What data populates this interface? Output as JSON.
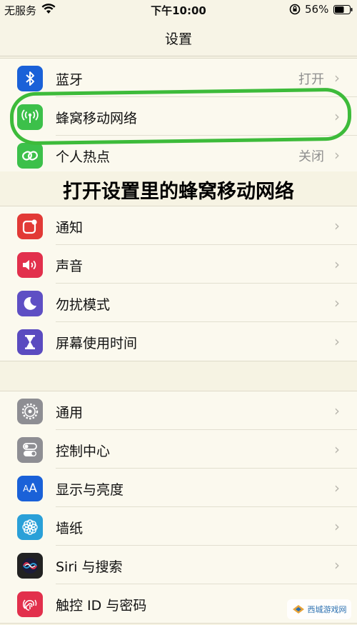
{
  "status_bar": {
    "carrier": "无服务",
    "time": "下午10:00",
    "battery": "56%"
  },
  "nav": {
    "title": "设置"
  },
  "group1": [
    {
      "label": "蓝牙",
      "value": "打开",
      "icon": "bluetooth-icon",
      "color": "#1a61d8"
    },
    {
      "label": "蜂窝移动网络",
      "value": "",
      "icon": "antenna-icon",
      "color": "#3cc04a"
    },
    {
      "label": "个人热点",
      "value": "关闭",
      "icon": "hotspot-icon",
      "color": "#3cc04a"
    }
  ],
  "caption": "打开设置里的蜂窝移动网络",
  "group2": [
    {
      "label": "通知",
      "icon": "notification-icon",
      "color": "#e23a36"
    },
    {
      "label": "声音",
      "icon": "speaker-icon",
      "color": "#e2304c"
    },
    {
      "label": "勿扰模式",
      "icon": "moon-icon",
      "color": "#5e4fc4"
    },
    {
      "label": "屏幕使用时间",
      "icon": "hourglass-icon",
      "color": "#5a4bc0"
    }
  ],
  "group3": [
    {
      "label": "通用",
      "icon": "gear-icon",
      "color": "#8e8e93"
    },
    {
      "label": "控制中心",
      "icon": "toggles-icon",
      "color": "#8e8e93"
    },
    {
      "label": "显示与亮度",
      "icon": "text-size-icon",
      "color": "#1a61d8"
    },
    {
      "label": "墙纸",
      "icon": "flower-icon",
      "color": "#2aa0d8"
    },
    {
      "label": "Siri 与搜索",
      "icon": "siri-icon",
      "color": "#222222"
    },
    {
      "label": "触控 ID 与密码",
      "icon": "fingerprint-icon",
      "color": "#e2304c"
    }
  ],
  "watermark": "西城游戏网",
  "colors": {
    "highlight": "#3dbb3a",
    "background": "#f6f3e3"
  }
}
